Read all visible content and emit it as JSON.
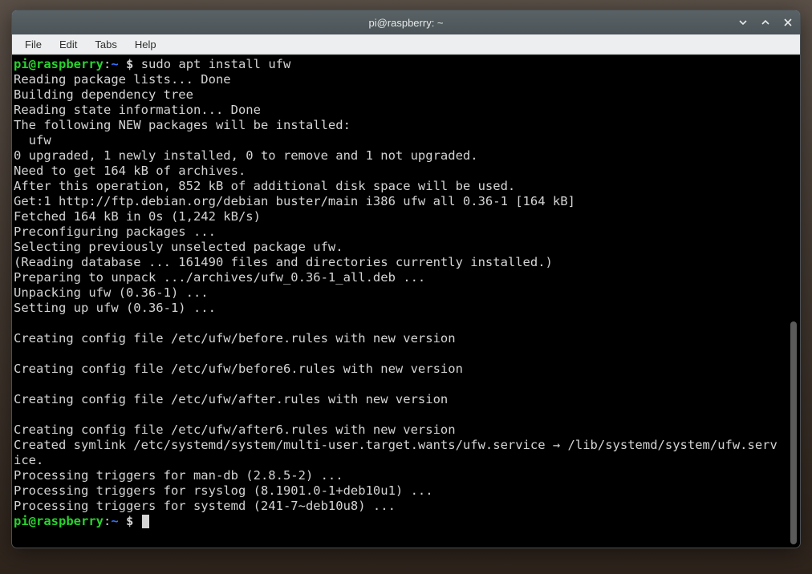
{
  "window": {
    "title": "pi@raspberry: ~"
  },
  "menubar": {
    "file": "File",
    "edit": "Edit",
    "tabs": "Tabs",
    "help": "Help"
  },
  "prompt": {
    "user": "pi",
    "at": "@",
    "host": "raspberry",
    "colon": ":",
    "path": "~",
    "dollar": " $ "
  },
  "command": "sudo apt install ufw",
  "output": [
    "Reading package lists... Done",
    "Building dependency tree",
    "Reading state information... Done",
    "The following NEW packages will be installed:",
    "  ufw",
    "0 upgraded, 1 newly installed, 0 to remove and 1 not upgraded.",
    "Need to get 164 kB of archives.",
    "After this operation, 852 kB of additional disk space will be used.",
    "Get:1 http://ftp.debian.org/debian buster/main i386 ufw all 0.36-1 [164 kB]",
    "Fetched 164 kB in 0s (1,242 kB/s)",
    "Preconfiguring packages ...",
    "Selecting previously unselected package ufw.",
    "(Reading database ... 161490 files and directories currently installed.)",
    "Preparing to unpack .../archives/ufw_0.36-1_all.deb ...",
    "Unpacking ufw (0.36-1) ...",
    "Setting up ufw (0.36-1) ...",
    "",
    "Creating config file /etc/ufw/before.rules with new version",
    "",
    "Creating config file /etc/ufw/before6.rules with new version",
    "",
    "Creating config file /etc/ufw/after.rules with new version",
    "",
    "Creating config file /etc/ufw/after6.rules with new version",
    "Created symlink /etc/systemd/system/multi-user.target.wants/ufw.service → /lib/systemd/system/ufw.service.",
    "Processing triggers for man-db (2.8.5-2) ...",
    "Processing triggers for rsyslog (8.1901.0-1+deb10u1) ...",
    "Processing triggers for systemd (241-7~deb10u8) ..."
  ]
}
